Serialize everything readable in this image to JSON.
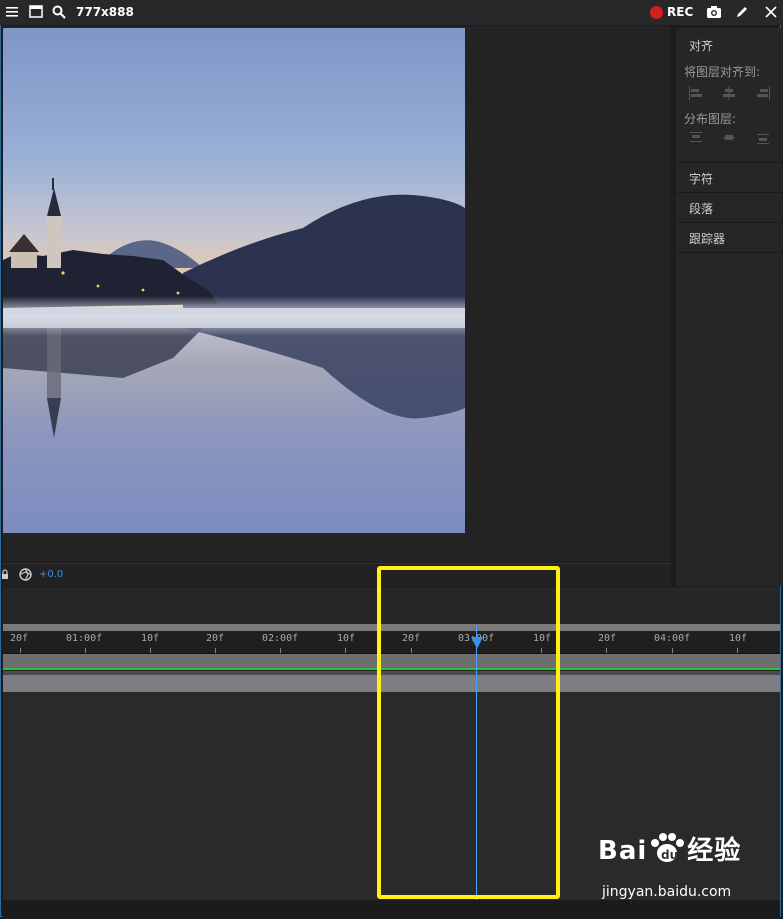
{
  "topbar": {
    "dimensions": "777x888",
    "rec_label": "REC",
    "icons": [
      "menu-icon",
      "window-icon",
      "search-icon",
      "camera-icon",
      "pen-icon",
      "close-icon"
    ]
  },
  "composition": {
    "exposure_value": "+0.0",
    "icons": [
      "lock-icon",
      "exposure-icon"
    ]
  },
  "align_panel": {
    "title": "对齐",
    "align_to_label": "将图层对齐到:",
    "distribute_label": "分布图层:",
    "sections": [
      "字符",
      "段落",
      "跟踪器"
    ]
  },
  "timeline": {
    "ruler_labels": [
      "20f",
      "01:00f",
      "10f",
      "20f",
      "02:00f",
      "10f",
      "20f",
      "03:00f",
      "10f",
      "20f",
      "04:00f",
      "10f"
    ],
    "playhead_time": "03:00f",
    "colors": {
      "playhead": "#3a8fe8",
      "work_area": "#2fbf3a",
      "highlight": "#ffef14"
    }
  },
  "watermark": {
    "brand": "Bai",
    "brand_suffix": "经验",
    "url": "jingyan.baidu.com"
  }
}
